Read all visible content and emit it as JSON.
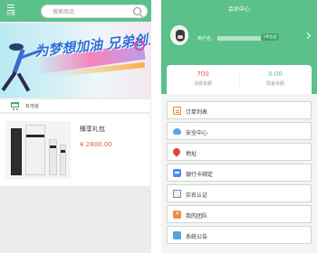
{
  "left": {
    "category_label": "分类",
    "search": {
      "placeholder": "搜索商品"
    },
    "banner": {
      "slogan": "为梦想加油 兄弟创业吧"
    },
    "store_label": "有地金",
    "product": {
      "name": "臻享礼包",
      "price": "¥ 2800.00"
    }
  },
  "right": {
    "title": "会员中心",
    "user": {
      "label": "用户名：",
      "badge": "VIP会员"
    },
    "stats": [
      {
        "value": "700",
        "label": "消费余额"
      },
      {
        "value": "0.00",
        "label": "现金余额"
      }
    ],
    "menu": [
      {
        "label": "订单列表",
        "icon": "order-icon"
      },
      {
        "label": "安全中心",
        "icon": "cloud-icon"
      },
      {
        "label": "地址",
        "icon": "location-pin-icon"
      },
      {
        "label": "银行卡绑定",
        "icon": "bank-card-icon"
      },
      {
        "label": "实名认证",
        "icon": "id-card-icon"
      },
      {
        "label": "我的团队",
        "icon": "team-icon"
      },
      {
        "label": "系统公告",
        "icon": "notice-icon"
      }
    ]
  },
  "colors": {
    "brand": "#5cc08b",
    "price": "#e9574a"
  }
}
